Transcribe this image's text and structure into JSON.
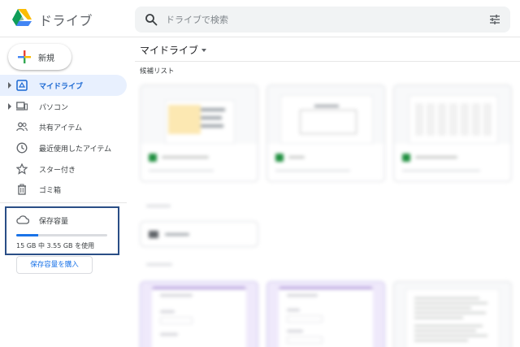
{
  "app": {
    "title": "ドライブ",
    "search_placeholder": "ドライブで検索",
    "icons": {
      "logo": "google-drive-logo",
      "search": "search-icon",
      "tune": "tune-icon"
    }
  },
  "sidebar": {
    "new_label": "新規",
    "items": [
      {
        "label": "マイドライブ",
        "icon": "my-drive-icon",
        "active": true,
        "expandable": true
      },
      {
        "label": "パソコン",
        "icon": "computer-icon",
        "active": false,
        "expandable": true
      },
      {
        "label": "共有アイテム",
        "icon": "shared-icon",
        "active": false,
        "expandable": false
      },
      {
        "label": "最近使用したアイテム",
        "icon": "clock-icon",
        "active": false,
        "expandable": false
      },
      {
        "label": "スター付き",
        "icon": "star-icon",
        "active": false,
        "expandable": false
      },
      {
        "label": "ゴミ箱",
        "icon": "trash-icon",
        "active": false,
        "expandable": false
      }
    ],
    "storage": {
      "label": "保存容量",
      "usage_text": "15 GB 中 3.55 GB を使用",
      "used_fraction": 0.237,
      "buy_label": "保存容量を購入"
    }
  },
  "main": {
    "title": "マイドライブ",
    "suggested_label": "候補リスト"
  },
  "colors": {
    "accent": "#1a73e8",
    "active_bg": "#e8f0fe",
    "highlight_border": "#2a4e86",
    "sheets_green": "#1e8e3e"
  }
}
